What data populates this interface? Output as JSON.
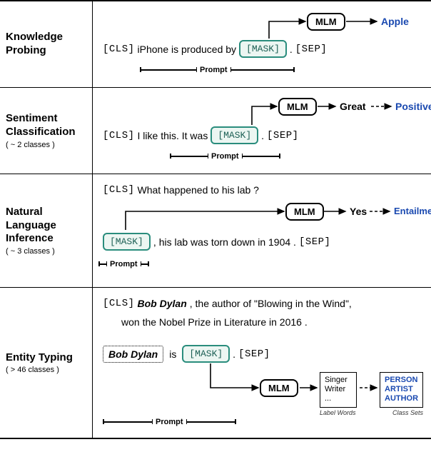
{
  "rows": {
    "knowledge": {
      "title": "Knowledge Probing",
      "sub": "",
      "cls": "[CLS]",
      "text1": "iPhone is produced by",
      "mask": "[MASK]",
      "period": ".",
      "sep": "[SEP]",
      "mlm": "MLM",
      "out": "Apple",
      "prompt_label": "Prompt"
    },
    "sentiment": {
      "title": "Sentiment Classification",
      "sub": "( ~ 2 classes )",
      "cls": "[CLS]",
      "text1": "I like this. It was",
      "mask": "[MASK]",
      "period": ".",
      "sep": "[SEP]",
      "mlm": "MLM",
      "out1": "Great",
      "out2": "Positive",
      "prompt_label": "Prompt"
    },
    "nli": {
      "title": "Natural Language Inference",
      "sub": "( ~ 3 classes )",
      "cls": "[CLS]",
      "premise": "What happened to his lab ?",
      "mask": "[MASK]",
      "comma": ",",
      "hypothesis": "his lab was torn down in 1904 .",
      "sep": "[SEP]",
      "mlm": "MLM",
      "out1": "Yes",
      "out2": "Entailment",
      "prompt_label": "Prompt"
    },
    "entity": {
      "title": "Entity Typing",
      "sub": "( > 46 classes )",
      "cls": "[CLS]",
      "entity_span": "Bob Dylan",
      "sent_part1": ", the author of \"Blowing in the Wind\",",
      "sent_part2": "won the Nobel Prize in Literature in 2016 .",
      "entity_box": "Bob Dylan",
      "is_word": "is",
      "mask": "[MASK]",
      "period": ".",
      "sep": "[SEP]",
      "mlm": "MLM",
      "label_words": "Singer\nWriter\n...",
      "label_words_caption": "Label Words",
      "class_sets": "PERSON\nARTIST\nAUTHOR",
      "class_sets_caption": "Class Sets",
      "prompt_label": "Prompt"
    }
  }
}
